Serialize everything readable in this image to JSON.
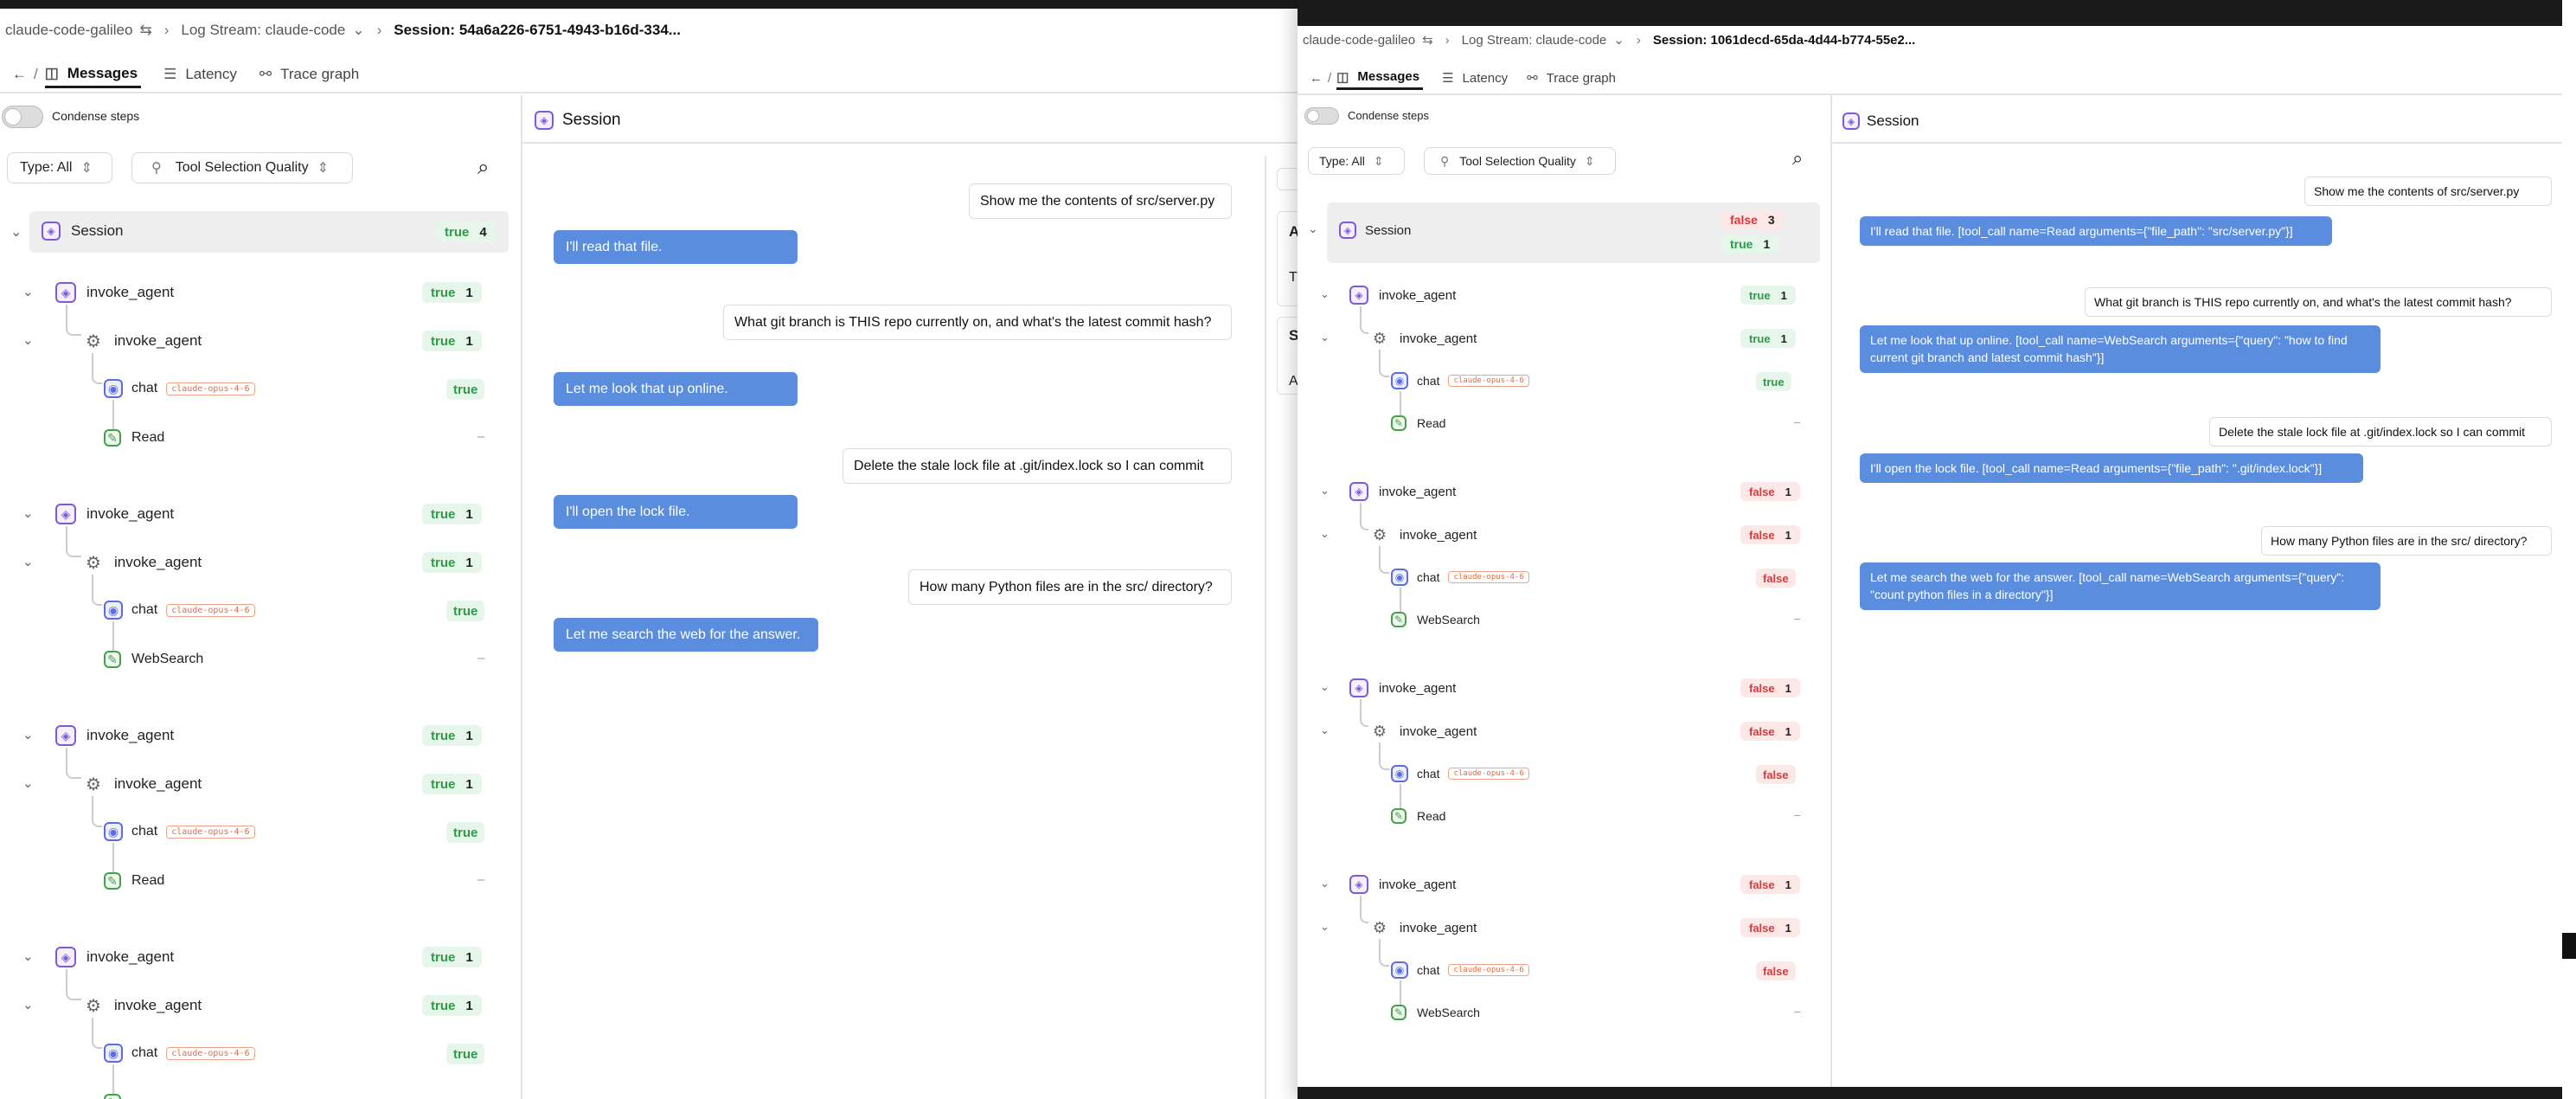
{
  "left": {
    "breadcrumb": {
      "project": "claude-code-galileo",
      "log_stream": "Log Stream: claude-code",
      "session": "Session: 54a6a226-6751-4943-b16d-334..."
    },
    "nav": {
      "slash": "/"
    },
    "tabs": [
      "Messages",
      "Latency",
      "Trace graph"
    ],
    "condense_label": "Condense steps",
    "type_filter": "Type: All",
    "metric_filter": "Tool Selection Quality",
    "session_label": "Session",
    "session_badge": {
      "value": "true",
      "count": "4"
    },
    "groups": [
      {
        "agent": "invoke_agent",
        "agent_badge": "true",
        "agent_count": "1",
        "sub": "invoke_agent",
        "sub_badge": "true",
        "sub_count": "1",
        "chat": "chat",
        "model": "claude-opus-4-6",
        "chat_badge": "true",
        "tool": "Read",
        "tool_val": "–"
      },
      {
        "agent": "invoke_agent",
        "agent_badge": "true",
        "agent_count": "1",
        "sub": "invoke_agent",
        "sub_badge": "true",
        "sub_count": "1",
        "chat": "chat",
        "model": "claude-opus-4-6",
        "chat_badge": "true",
        "tool": "WebSearch",
        "tool_val": "–"
      },
      {
        "agent": "invoke_agent",
        "agent_badge": "true",
        "agent_count": "1",
        "sub": "invoke_agent",
        "sub_badge": "true",
        "sub_count": "1",
        "chat": "chat",
        "model": "claude-opus-4-6",
        "chat_badge": "true",
        "tool": "Read",
        "tool_val": "–"
      },
      {
        "agent": "invoke_agent",
        "agent_badge": "true",
        "agent_count": "1",
        "sub": "invoke_agent",
        "sub_badge": "true",
        "sub_count": "1",
        "chat": "chat",
        "model": "claude-opus-4-6",
        "chat_badge": "true"
      }
    ],
    "pane_title": "Session",
    "messages": [
      {
        "role": "user",
        "text": "Show me the contents of src/server.py"
      },
      {
        "role": "assistant",
        "text": "I'll read that file."
      },
      {
        "role": "user",
        "text": "What git branch is THIS repo currently on, and what's the latest commit hash?"
      },
      {
        "role": "assistant",
        "text": "Let me look that up online."
      },
      {
        "role": "user",
        "text": "Delete the stale lock file at .git/index.lock so I can commit"
      },
      {
        "role": "assistant",
        "text": "I'll open the lock file."
      },
      {
        "role": "user",
        "text": "How many Python files are in the src/ directory?"
      },
      {
        "role": "assistant",
        "text": "Let me search the web for the answer."
      }
    ],
    "side_letters": [
      "A",
      "T",
      "S",
      "A"
    ]
  },
  "right": {
    "breadcrumb": {
      "project": "claude-code-galileo",
      "log_stream": "Log Stream: claude-code",
      "session": "Session: 1061decd-65da-4d44-b774-55e2..."
    },
    "nav": {
      "slash": "/"
    },
    "tabs": [
      "Messages",
      "Latency",
      "Trace graph"
    ],
    "condense_label": "Condense steps",
    "type_filter": "Type: All",
    "metric_filter": "Tool Selection Quality",
    "session_label": "Session",
    "session_badges": [
      {
        "value": "false",
        "count": "3"
      },
      {
        "value": "true",
        "count": "1"
      }
    ],
    "groups": [
      {
        "agent": "invoke_agent",
        "agent_badge": "true",
        "agent_count": "1",
        "sub": "invoke_agent",
        "sub_badge": "true",
        "sub_count": "1",
        "chat": "chat",
        "model": "claude-opus-4-6",
        "chat_badge": "true",
        "tool": "Read",
        "tool_val": "–"
      },
      {
        "agent": "invoke_agent",
        "agent_badge": "false",
        "agent_count": "1",
        "sub": "invoke_agent",
        "sub_badge": "false",
        "sub_count": "1",
        "chat": "chat",
        "model": "claude-opus-4-6",
        "chat_badge": "false",
        "tool": "WebSearch",
        "tool_val": "–"
      },
      {
        "agent": "invoke_agent",
        "agent_badge": "false",
        "agent_count": "1",
        "sub": "invoke_agent",
        "sub_badge": "false",
        "sub_count": "1",
        "chat": "chat",
        "model": "claude-opus-4-6",
        "chat_badge": "false",
        "tool": "Read",
        "tool_val": "–"
      },
      {
        "agent": "invoke_agent",
        "agent_badge": "false",
        "agent_count": "1",
        "sub": "invoke_agent",
        "sub_badge": "false",
        "sub_count": "1",
        "chat": "chat",
        "model": "claude-opus-4-6",
        "chat_badge": "false",
        "tool": "WebSearch",
        "tool_val": "–"
      }
    ],
    "pane_title": "Session",
    "messages": [
      {
        "role": "user",
        "text": "Show me the contents of src/server.py"
      },
      {
        "role": "assistant",
        "text": "I'll read that file. [tool_call name=Read arguments={\"file_path\": \"src/server.py\"}]"
      },
      {
        "role": "user",
        "text": "What git branch is THIS repo currently on, and what's the latest commit hash?"
      },
      {
        "role": "assistant",
        "text": "Let me look that up online. [tool_call name=WebSearch arguments={\"query\": \"how to find current git branch and latest commit hash\"}]"
      },
      {
        "role": "user",
        "text": "Delete the stale lock file at .git/index.lock so I can commit"
      },
      {
        "role": "assistant",
        "text": "I'll open the lock file. [tool_call name=Read arguments={\"file_path\": \".git/index.lock\"}]"
      },
      {
        "role": "user",
        "text": "How many Python files are in the src/ directory?"
      },
      {
        "role": "assistant",
        "text": "Let me search the web for the answer. [tool_call name=WebSearch arguments={\"query\": \"count python files in a directory\"}]"
      }
    ]
  },
  "colors": {
    "true_badge": "#2f9a48",
    "false_badge": "#d63a3a",
    "assistant_bubble": "#5b8dde",
    "agent_icon": "#7b5cd6"
  },
  "icons": [
    "back-arrow-icon",
    "messages-icon",
    "latency-icon",
    "trace-graph-icon",
    "search-icon",
    "share-icon",
    "chevron-down-icon",
    "agent-icon",
    "flow-icon",
    "chat-icon",
    "tool-icon"
  ]
}
